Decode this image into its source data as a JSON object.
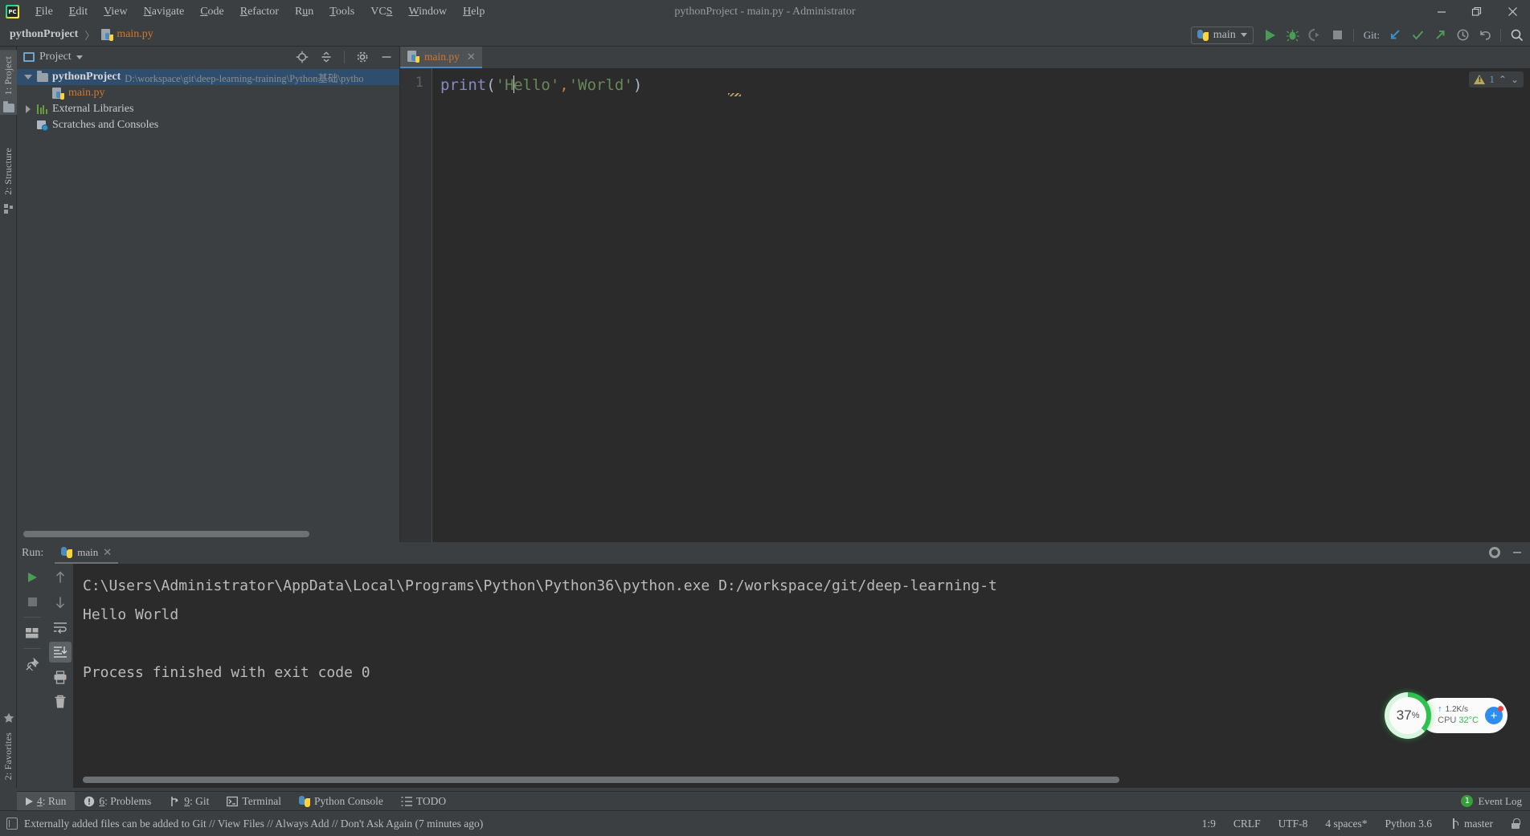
{
  "window": {
    "title": "pythonProject - main.py - Administrator",
    "app_icon": "pycharm-logo-icon",
    "minimize": "–",
    "restore": "❐",
    "close": "✕"
  },
  "menubar": {
    "items": [
      {
        "mnemonic": "F",
        "rest": "ile"
      },
      {
        "mnemonic": "E",
        "rest": "dit"
      },
      {
        "mnemonic": "V",
        "rest": "iew"
      },
      {
        "mnemonic": "N",
        "rest": "avigate"
      },
      {
        "mnemonic": "C",
        "rest": "ode"
      },
      {
        "mnemonic": "R",
        "rest": "efactor"
      },
      {
        "mnemonic": "R",
        "rest": "un",
        "pre": "R",
        "mn_index": 2
      },
      {
        "mnemonic": "T",
        "rest": "ools"
      },
      {
        "mnemonic": "S",
        "rest": "VCS"
      },
      {
        "mnemonic": "W",
        "rest": "indow"
      },
      {
        "mnemonic": "H",
        "rest": "elp"
      }
    ],
    "labels": [
      "File",
      "Edit",
      "View",
      "Navigate",
      "Code",
      "Refactor",
      "Run",
      "Tools",
      "VCS",
      "Window",
      "Help"
    ]
  },
  "breadcrumb": {
    "project": "pythonProject",
    "separator": "〉",
    "file": "main.py"
  },
  "toolbar": {
    "run_config": "main",
    "run_tooltip": "Run",
    "debug_tooltip": "Debug",
    "coverage_tooltip": "Run with Coverage",
    "stop_tooltip": "Stop",
    "git_label": "Git:",
    "update_tooltip": "Update Project",
    "commit_tooltip": "Commit",
    "push_tooltip": "Push",
    "history_tooltip": "History",
    "rollback_tooltip": "Rollback",
    "search_tooltip": "Search Everywhere"
  },
  "rail": {
    "project": "1: Project",
    "project_num": "1",
    "project_rest": ": Project",
    "structure": "2: Structure",
    "structure_num": "2",
    "structure_rest": ": Structure",
    "favorites": "2: Favorites",
    "favorites_num": "2",
    "favorites_rest": ": Favorites"
  },
  "project_panel": {
    "title": "Project",
    "locate_tooltip": "Select Opened File",
    "collapse_tooltip": "Collapse All",
    "settings_tooltip": "Show Options Menu",
    "hide_tooltip": "Hide",
    "tree": [
      {
        "name": "pythonProject",
        "path": "D:\\workspace\\git\\deep-learning-training\\Python基础\\pytho",
        "type": "project-root",
        "selected": true,
        "expanded": true
      },
      {
        "name": "main.py",
        "type": "python-file",
        "selected": false
      },
      {
        "name": "External Libraries",
        "type": "libraries",
        "selected": false,
        "expanded": false
      },
      {
        "name": "Scratches and Consoles",
        "type": "scratches",
        "selected": false
      }
    ]
  },
  "editor": {
    "tab": {
      "label": "main.py",
      "close": "✕"
    },
    "line_numbers": [
      "1"
    ],
    "code": {
      "fn": "print",
      "lparen": "(",
      "str1_open": "'",
      "str1_a": "H",
      "str1_b": "ello",
      "str1_close": "'",
      "comma": ",",
      "str2": "'World'",
      "rparen": ")"
    },
    "code_plain": "print('Hello','World')",
    "inspection": {
      "count": "1",
      "up": "⌃",
      "down": "⌄"
    }
  },
  "run_panel": {
    "label": "Run:",
    "tab": "main",
    "tab_close": "✕",
    "rerun_tooltip": "Rerun",
    "stop_tooltip": "Stop",
    "layout_tooltip": "Layout Settings",
    "pin_tooltip": "Pin Tab",
    "up_tooltip": "Up",
    "down_tooltip": "Down",
    "wrap_tooltip": "Use Soft Wraps",
    "scroll_end_tooltip": "Scroll to End",
    "print_tooltip": "Print",
    "clear_tooltip": "Clear All",
    "settings_tooltip": "Settings",
    "hide_tooltip": "Hide",
    "console_lines": [
      "C:\\Users\\Administrator\\AppData\\Local\\Programs\\Python\\Python36\\python.exe D:/workspace/git/deep-learning-t",
      "Hello World",
      "",
      "Process finished with exit code 0"
    ]
  },
  "cpu_widget": {
    "percent": "37",
    "percent_symbol": "%",
    "net_arrow": "↑",
    "net_speed": "1.2K/s",
    "cpu_label": "CPU",
    "cpu_temp": "32°C",
    "add_button": "+",
    "ring_color": "#2fc14f",
    "accent_blue": "#2e8ded"
  },
  "bottom_tabs": {
    "items": [
      {
        "num": "4",
        "rest": ": Run",
        "label": "4: Run",
        "icon": "play-icon",
        "active": true
      },
      {
        "num": "6",
        "rest": ": Problems",
        "label": "6: Problems",
        "icon": "problems-icon",
        "active": false
      },
      {
        "num": "9",
        "rest": ": Git",
        "label": "9: Git",
        "icon": "git-branch-icon",
        "active": false
      },
      {
        "num": "",
        "rest": "Terminal",
        "label": "Terminal",
        "icon": "terminal-icon",
        "active": false
      },
      {
        "num": "",
        "rest": "Python Console",
        "label": "Python Console",
        "icon": "python-icon",
        "active": false
      },
      {
        "num": "",
        "rest": "TODO",
        "label": "TODO",
        "icon": "todo-list-icon",
        "active": false
      }
    ],
    "event_log": {
      "label": "Event Log",
      "badge": "1"
    }
  },
  "statusbar": {
    "message": "Externally added files can be added to Git // View Files // Always Add // Don't Ask Again (7 minutes ago)",
    "caret_position": "1:9",
    "line_separator": "CRLF",
    "encoding": "UTF-8",
    "indent": "4 spaces*",
    "interpreter": "Python 3.6",
    "branch": "master"
  }
}
